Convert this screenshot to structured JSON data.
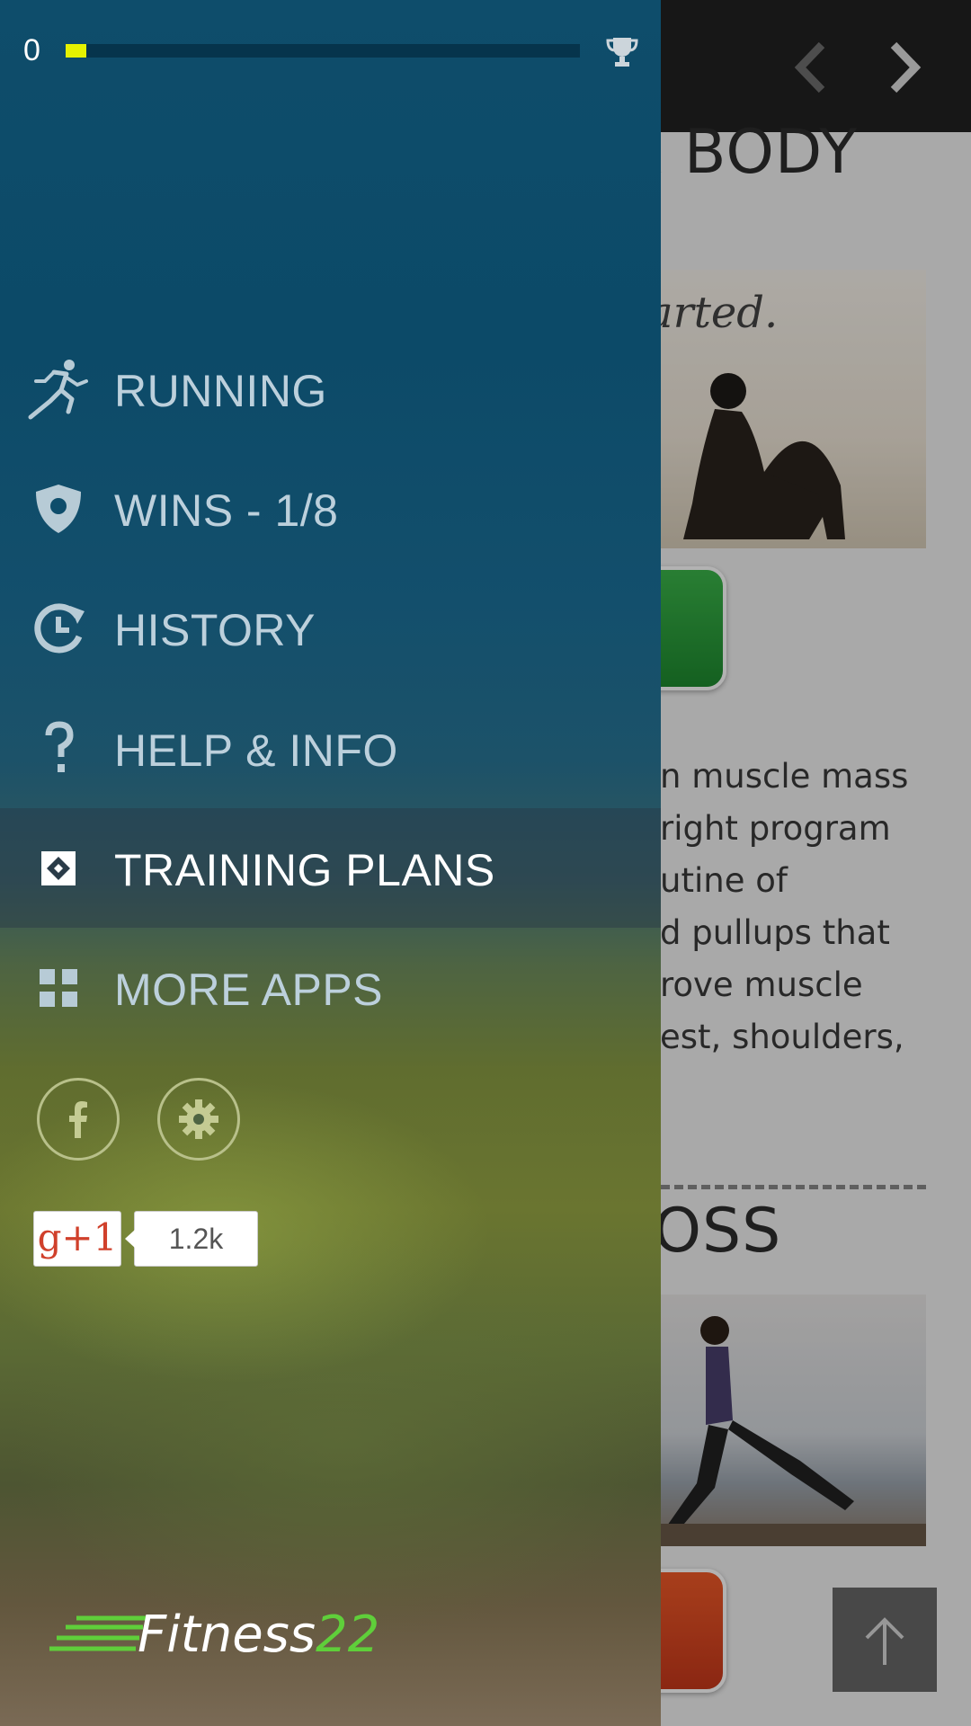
{
  "background": {
    "heading_1": "R BODY",
    "photo_1_caption": "arted.",
    "paragraph_lines": [
      "n muscle mass",
      " right program",
      "utine of",
      "d pullups that",
      "rove muscle",
      "est, shoulders,"
    ],
    "heading_2": "LOSS"
  },
  "drawer": {
    "progress": {
      "value_label": "0",
      "fill_fraction": 0.04
    },
    "menu": [
      {
        "id": "running",
        "label": "RUNNING",
        "icon": "runner-icon",
        "selected": false
      },
      {
        "id": "wins",
        "label": "WINS - 1/8",
        "icon": "shield-icon",
        "selected": false
      },
      {
        "id": "history",
        "label": "HISTORY",
        "icon": "history-icon",
        "selected": false
      },
      {
        "id": "help",
        "label": "HELP & INFO",
        "icon": "question-icon",
        "selected": false
      },
      {
        "id": "training",
        "label": "TRAINING PLANS",
        "icon": "training-plans-icon",
        "selected": true
      },
      {
        "id": "more",
        "label": "MORE APPS",
        "icon": "grid-icon",
        "selected": false
      }
    ],
    "social": {
      "gplus_label": "g+1",
      "gplus_count": "1.2k"
    },
    "logo": {
      "text": "Fitness",
      "number": "22"
    }
  },
  "colors": {
    "progress_fill": "#e5f200",
    "drawer_top": "#0e4d6b",
    "logo_accent": "#5fcf3a",
    "gplus_red": "#d0402b"
  }
}
